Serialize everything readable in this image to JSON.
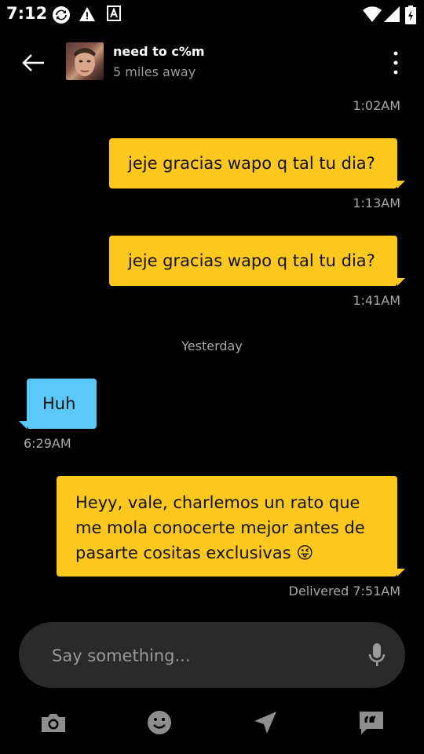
{
  "status_bar": {
    "time": "7:12",
    "icons": [
      "sync-icon",
      "warning-icon",
      "text-a-icon",
      "wifi-icon",
      "signal-icon",
      "battery-icon"
    ]
  },
  "header": {
    "title": "need to c%m",
    "subtitle": "5 miles away"
  },
  "messages": [
    {
      "type": "timestamp",
      "text": "1:02AM"
    },
    {
      "type": "outgoing",
      "text": "jeje gracias wapo q tal tu dia?",
      "time": "1:13AM"
    },
    {
      "type": "outgoing",
      "text": "jeje gracias wapo q tal tu dia?",
      "time": "1:41AM"
    },
    {
      "type": "day_divider",
      "text": "Yesterday"
    },
    {
      "type": "incoming",
      "text": "Huh",
      "time": "6:29AM"
    },
    {
      "type": "outgoing",
      "lines": [
        "Heyy, vale, charlemos un rato que",
        "me mola conocerte mejor antes de",
        "pasarte cositas exclusivas"
      ],
      "emoji": "😜",
      "time": "Delivered 7:51AM"
    }
  ],
  "composer": {
    "placeholder": "Say something..."
  },
  "toolbar": {
    "items": [
      "camera-icon",
      "emoji-icon",
      "location-icon",
      "quick-reply-icon"
    ]
  },
  "colors": {
    "outgoing_bubble": "#ffc81e",
    "incoming_bubble": "#5ac8fa",
    "background": "#000000",
    "composer_bg": "#2a2a2a"
  }
}
